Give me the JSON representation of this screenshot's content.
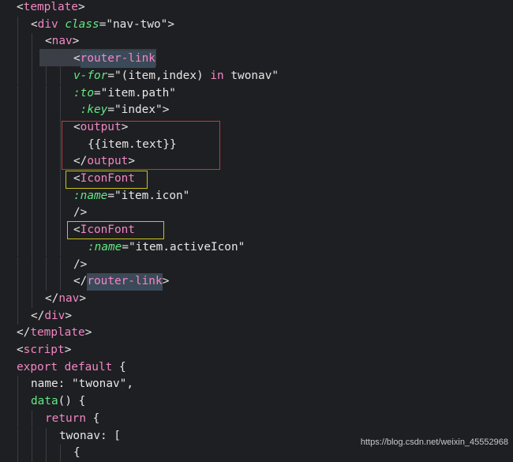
{
  "lines": [
    {
      "indent": 0,
      "tokens": [
        [
          "punc",
          "<"
        ],
        [
          "tag",
          "template"
        ],
        [
          "punc",
          ">"
        ]
      ]
    },
    {
      "indent": 1,
      "tokens": [
        [
          "punc",
          "<"
        ],
        [
          "tag",
          "div "
        ],
        [
          "attr",
          "class"
        ],
        [
          "punc",
          "="
        ],
        [
          "str",
          "\"nav-two\""
        ],
        [
          "punc",
          ">"
        ]
      ]
    },
    {
      "indent": 2,
      "tokens": [
        [
          "punc",
          "<"
        ],
        [
          "tag",
          "nav"
        ],
        [
          "punc",
          ">"
        ]
      ]
    },
    {
      "indent": 4,
      "tokens": [
        [
          "punc",
          "<"
        ],
        [
          "hl",
          "router-link"
        ]
      ]
    },
    {
      "indent": 4,
      "tokens": [
        [
          "attr",
          "v-for"
        ],
        [
          "punc",
          "="
        ],
        [
          "str",
          "\"(item,index) "
        ],
        [
          "kw",
          "in"
        ],
        [
          "str",
          " twonav\""
        ]
      ]
    },
    {
      "indent": 4,
      "tokens": [
        [
          "attr",
          ":to"
        ],
        [
          "punc",
          "="
        ],
        [
          "str",
          "\"item.path\""
        ]
      ]
    },
    {
      "indent": 4,
      "tokens": [
        [
          "attr",
          " :key"
        ],
        [
          "punc",
          "="
        ],
        [
          "str",
          "\"index\""
        ],
        [
          "punc",
          ">"
        ]
      ]
    },
    {
      "indent": 4,
      "tokens": [
        [
          "punc",
          "<"
        ],
        [
          "tag",
          "output"
        ],
        [
          "punc",
          ">"
        ]
      ]
    },
    {
      "indent": 5,
      "tokens": [
        [
          "plain",
          "{{item.text}}"
        ]
      ]
    },
    {
      "indent": 4,
      "tokens": [
        [
          "punc",
          "</"
        ],
        [
          "tag",
          "output"
        ],
        [
          "punc",
          ">"
        ]
      ]
    },
    {
      "indent": 4,
      "tokens": [
        [
          "punc",
          "<"
        ],
        [
          "tag",
          "IconFont"
        ]
      ]
    },
    {
      "indent": 4,
      "tokens": [
        [
          "attr",
          ":name"
        ],
        [
          "punc",
          "="
        ],
        [
          "str",
          "\"item.icon\""
        ]
      ]
    },
    {
      "indent": 4,
      "tokens": [
        [
          "punc",
          "/>"
        ]
      ]
    },
    {
      "indent": 4,
      "tokens": [
        [
          "punc",
          "<"
        ],
        [
          "tag",
          "IconFont"
        ]
      ]
    },
    {
      "indent": 5,
      "tokens": [
        [
          "attr",
          ":name"
        ],
        [
          "punc",
          "="
        ],
        [
          "str",
          "\"item.activeIcon\""
        ]
      ]
    },
    {
      "indent": 4,
      "tokens": [
        [
          "punc",
          "/>"
        ]
      ]
    },
    {
      "indent": 4,
      "tokens": [
        [
          "punc",
          "</"
        ],
        [
          "hl",
          "router-link"
        ],
        [
          "punc",
          ">"
        ]
      ]
    },
    {
      "indent": 2,
      "tokens": [
        [
          "punc",
          "</"
        ],
        [
          "tag",
          "nav"
        ],
        [
          "punc",
          ">"
        ]
      ]
    },
    {
      "indent": 1,
      "tokens": [
        [
          "punc",
          "</"
        ],
        [
          "tag",
          "div"
        ],
        [
          "punc",
          ">"
        ]
      ]
    },
    {
      "indent": 0,
      "tokens": [
        [
          "punc",
          "</"
        ],
        [
          "tag",
          "template"
        ],
        [
          "punc",
          ">"
        ]
      ]
    },
    {
      "indent": 0,
      "tokens": [
        [
          "punc",
          "<"
        ],
        [
          "tag",
          "script"
        ],
        [
          "punc",
          ">"
        ]
      ]
    },
    {
      "indent": 0,
      "tokens": [
        [
          "kw",
          "export default"
        ],
        [
          "plain",
          " {"
        ]
      ]
    },
    {
      "indent": 1,
      "tokens": [
        [
          "plain",
          "name: "
        ],
        [
          "str",
          "\"twonav\""
        ],
        [
          "plain",
          ","
        ]
      ]
    },
    {
      "indent": 1,
      "tokens": [
        [
          "fn",
          "data"
        ],
        [
          "plain",
          "() {"
        ]
      ]
    },
    {
      "indent": 2,
      "tokens": [
        [
          "kw",
          "return"
        ],
        [
          "plain",
          " {"
        ]
      ]
    },
    {
      "indent": 3,
      "tokens": [
        [
          "plain",
          "twonav: ["
        ]
      ]
    },
    {
      "indent": 4,
      "tokens": [
        [
          "plain",
          "{"
        ]
      ]
    }
  ],
  "watermark": "https://blog.csdn.net/weixin_45552968"
}
